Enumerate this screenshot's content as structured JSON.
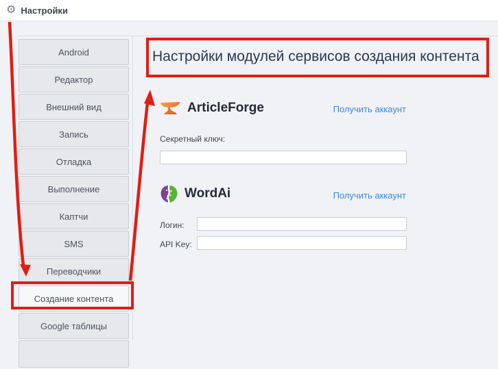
{
  "topbar": {
    "title": "Настройки",
    "icon": "gear-icon"
  },
  "sidebar": {
    "items": [
      {
        "label": "Android"
      },
      {
        "label": "Редактор"
      },
      {
        "label": "Внешний вид"
      },
      {
        "label": "Запись"
      },
      {
        "label": "Отладка"
      },
      {
        "label": "Выполнение"
      },
      {
        "label": "Каптчи"
      },
      {
        "label": "SMS"
      },
      {
        "label": "Переводчики"
      },
      {
        "label": "Создание контента",
        "active": true
      },
      {
        "label": "Google таблицы"
      }
    ]
  },
  "content": {
    "title": "Настройки модулей сервисов создания контента",
    "sections": [
      {
        "name": "ArticleForge",
        "icon": "articleforge-anvil-icon",
        "link": "Получить аккаунт",
        "fields": [
          {
            "label": "Секретный ключ:",
            "value": ""
          }
        ]
      },
      {
        "name": "WordAi",
        "icon": "wordai-heads-icon",
        "link": "Получить аккаунт",
        "fields": [
          {
            "label": "Логин:",
            "value": ""
          },
          {
            "label": "API Key:",
            "value": ""
          }
        ]
      }
    ]
  },
  "annotations": {
    "color": "#e21d12",
    "boxes": [
      "title-highlight-box",
      "content-tab-highlight-box"
    ],
    "arrows": [
      "settings-to-content-tab-arrow",
      "content-tab-to-title-arrow"
    ]
  },
  "colors": {
    "panel_bg": "#f0f2f6",
    "tab_bg": "#e7e8eb",
    "link_blue": "#3b87de",
    "title_text": "#2c394d",
    "annotation_red": "#e21d12"
  }
}
